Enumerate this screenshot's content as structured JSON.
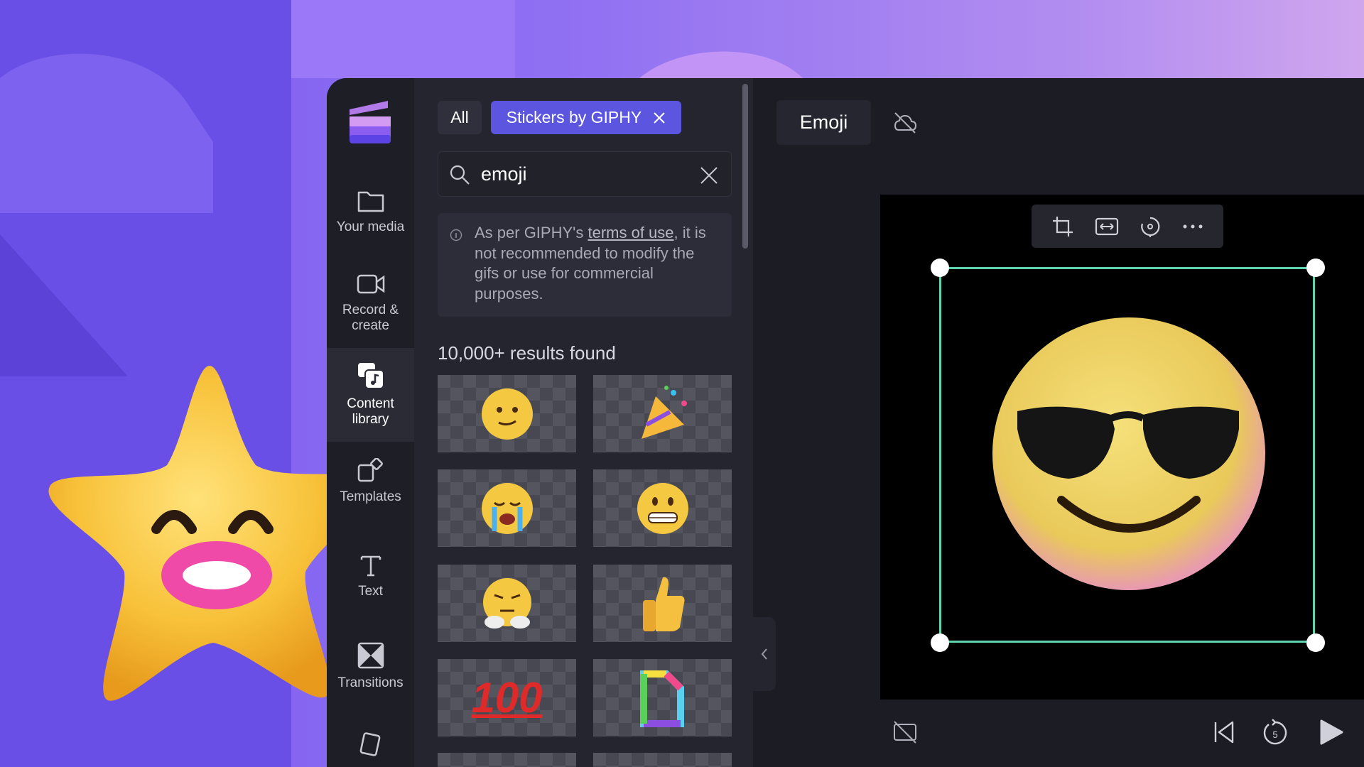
{
  "nav": {
    "items": [
      {
        "label": "Your media",
        "icon": "folder-icon"
      },
      {
        "label": "Record & create",
        "icon": "video-camera-icon"
      },
      {
        "label": "Content library",
        "icon": "content-library-icon",
        "selected": true
      },
      {
        "label": "Templates",
        "icon": "templates-icon"
      },
      {
        "label": "Text",
        "icon": "text-icon"
      },
      {
        "label": "Transitions",
        "icon": "transitions-icon"
      }
    ]
  },
  "panel": {
    "filters": {
      "all": "All",
      "active": "Stickers by GIPHY"
    },
    "search": {
      "value": "emoji"
    },
    "info": {
      "before": "As per GIPHY's ",
      "link": "terms of use",
      "after": ", it is not recommended to modify the gifs or use for commercial purposes."
    },
    "results": "10,000+ results found",
    "stickers": [
      "slightly-smiling-face",
      "party-popper",
      "loudly-crying-face",
      "grimacing-face",
      "steam-from-nose-face",
      "thumbs-up",
      "hundred-points",
      "giphy-logo"
    ],
    "hundred_text": "100"
  },
  "preview": {
    "title": "Emoji",
    "accent": "#5fd3b0",
    "selection_color": "#5fd3b0"
  },
  "colors": {
    "chip_active": "#5b55e0",
    "nav_bg": "#1e1e26",
    "panel_bg": "#25252f"
  }
}
